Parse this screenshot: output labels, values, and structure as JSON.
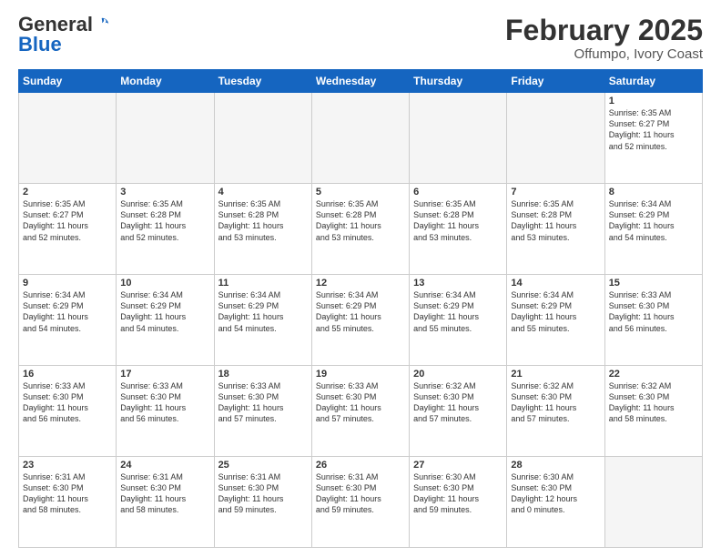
{
  "header": {
    "logo_general": "General",
    "logo_blue": "Blue",
    "month": "February 2025",
    "location": "Offumpo, Ivory Coast"
  },
  "weekdays": [
    "Sunday",
    "Monday",
    "Tuesday",
    "Wednesday",
    "Thursday",
    "Friday",
    "Saturday"
  ],
  "weeks": [
    [
      {
        "day": "",
        "info": ""
      },
      {
        "day": "",
        "info": ""
      },
      {
        "day": "",
        "info": ""
      },
      {
        "day": "",
        "info": ""
      },
      {
        "day": "",
        "info": ""
      },
      {
        "day": "",
        "info": ""
      },
      {
        "day": "1",
        "info": "Sunrise: 6:35 AM\nSunset: 6:27 PM\nDaylight: 11 hours\nand 52 minutes."
      }
    ],
    [
      {
        "day": "2",
        "info": "Sunrise: 6:35 AM\nSunset: 6:27 PM\nDaylight: 11 hours\nand 52 minutes."
      },
      {
        "day": "3",
        "info": "Sunrise: 6:35 AM\nSunset: 6:28 PM\nDaylight: 11 hours\nand 52 minutes."
      },
      {
        "day": "4",
        "info": "Sunrise: 6:35 AM\nSunset: 6:28 PM\nDaylight: 11 hours\nand 53 minutes."
      },
      {
        "day": "5",
        "info": "Sunrise: 6:35 AM\nSunset: 6:28 PM\nDaylight: 11 hours\nand 53 minutes."
      },
      {
        "day": "6",
        "info": "Sunrise: 6:35 AM\nSunset: 6:28 PM\nDaylight: 11 hours\nand 53 minutes."
      },
      {
        "day": "7",
        "info": "Sunrise: 6:35 AM\nSunset: 6:28 PM\nDaylight: 11 hours\nand 53 minutes."
      },
      {
        "day": "8",
        "info": "Sunrise: 6:34 AM\nSunset: 6:29 PM\nDaylight: 11 hours\nand 54 minutes."
      }
    ],
    [
      {
        "day": "9",
        "info": "Sunrise: 6:34 AM\nSunset: 6:29 PM\nDaylight: 11 hours\nand 54 minutes."
      },
      {
        "day": "10",
        "info": "Sunrise: 6:34 AM\nSunset: 6:29 PM\nDaylight: 11 hours\nand 54 minutes."
      },
      {
        "day": "11",
        "info": "Sunrise: 6:34 AM\nSunset: 6:29 PM\nDaylight: 11 hours\nand 54 minutes."
      },
      {
        "day": "12",
        "info": "Sunrise: 6:34 AM\nSunset: 6:29 PM\nDaylight: 11 hours\nand 55 minutes."
      },
      {
        "day": "13",
        "info": "Sunrise: 6:34 AM\nSunset: 6:29 PM\nDaylight: 11 hours\nand 55 minutes."
      },
      {
        "day": "14",
        "info": "Sunrise: 6:34 AM\nSunset: 6:29 PM\nDaylight: 11 hours\nand 55 minutes."
      },
      {
        "day": "15",
        "info": "Sunrise: 6:33 AM\nSunset: 6:30 PM\nDaylight: 11 hours\nand 56 minutes."
      }
    ],
    [
      {
        "day": "16",
        "info": "Sunrise: 6:33 AM\nSunset: 6:30 PM\nDaylight: 11 hours\nand 56 minutes."
      },
      {
        "day": "17",
        "info": "Sunrise: 6:33 AM\nSunset: 6:30 PM\nDaylight: 11 hours\nand 56 minutes."
      },
      {
        "day": "18",
        "info": "Sunrise: 6:33 AM\nSunset: 6:30 PM\nDaylight: 11 hours\nand 57 minutes."
      },
      {
        "day": "19",
        "info": "Sunrise: 6:33 AM\nSunset: 6:30 PM\nDaylight: 11 hours\nand 57 minutes."
      },
      {
        "day": "20",
        "info": "Sunrise: 6:32 AM\nSunset: 6:30 PM\nDaylight: 11 hours\nand 57 minutes."
      },
      {
        "day": "21",
        "info": "Sunrise: 6:32 AM\nSunset: 6:30 PM\nDaylight: 11 hours\nand 57 minutes."
      },
      {
        "day": "22",
        "info": "Sunrise: 6:32 AM\nSunset: 6:30 PM\nDaylight: 11 hours\nand 58 minutes."
      }
    ],
    [
      {
        "day": "23",
        "info": "Sunrise: 6:31 AM\nSunset: 6:30 PM\nDaylight: 11 hours\nand 58 minutes."
      },
      {
        "day": "24",
        "info": "Sunrise: 6:31 AM\nSunset: 6:30 PM\nDaylight: 11 hours\nand 58 minutes."
      },
      {
        "day": "25",
        "info": "Sunrise: 6:31 AM\nSunset: 6:30 PM\nDaylight: 11 hours\nand 59 minutes."
      },
      {
        "day": "26",
        "info": "Sunrise: 6:31 AM\nSunset: 6:30 PM\nDaylight: 11 hours\nand 59 minutes."
      },
      {
        "day": "27",
        "info": "Sunrise: 6:30 AM\nSunset: 6:30 PM\nDaylight: 11 hours\nand 59 minutes."
      },
      {
        "day": "28",
        "info": "Sunrise: 6:30 AM\nSunset: 6:30 PM\nDaylight: 12 hours\nand 0 minutes."
      },
      {
        "day": "",
        "info": ""
      }
    ]
  ]
}
